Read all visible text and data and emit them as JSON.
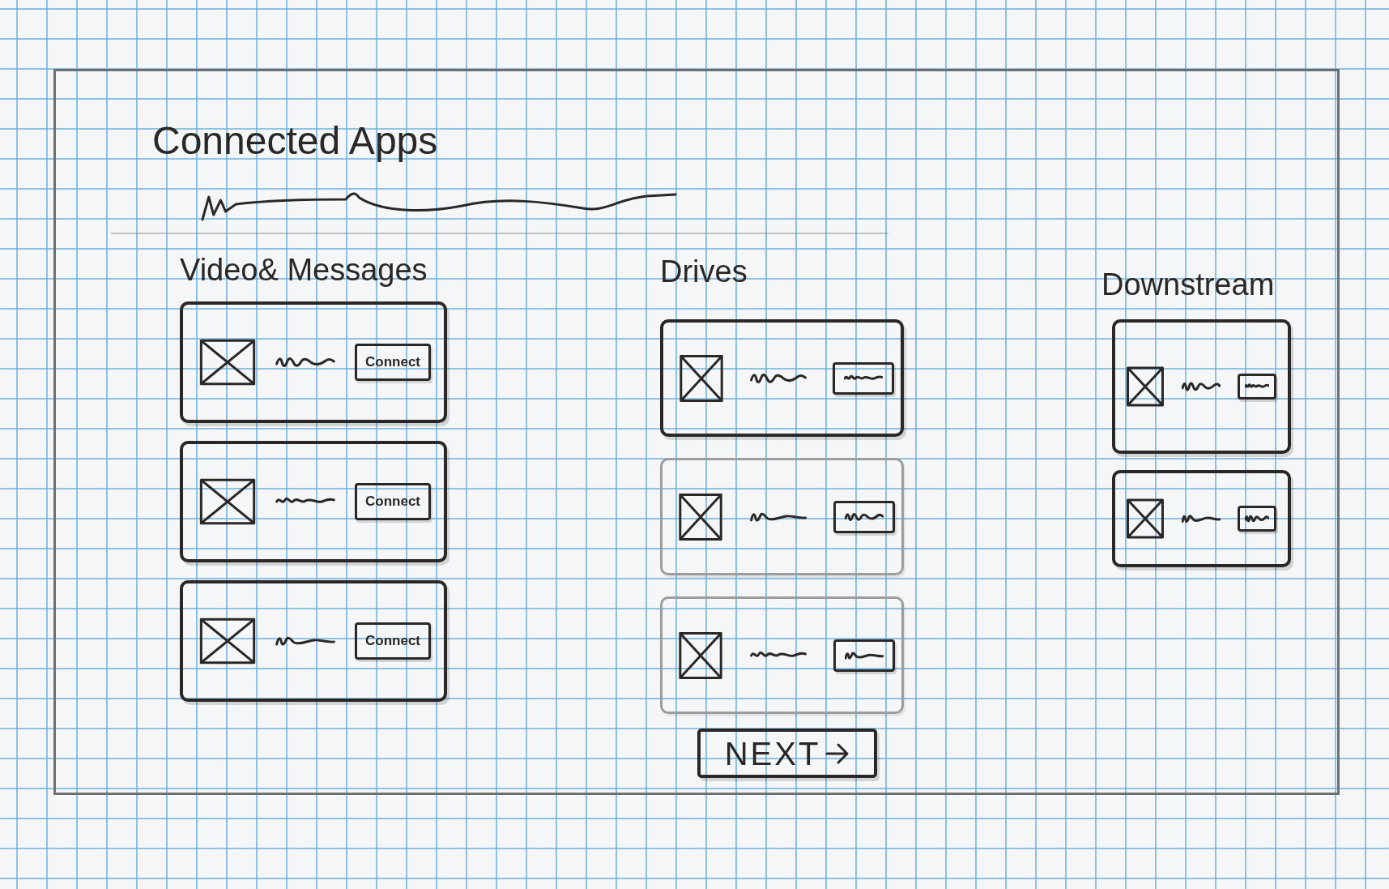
{
  "title": "Connected Apps",
  "columns": [
    {
      "heading": "Video& Messages",
      "cards": [
        {
          "dimmed": false,
          "button": {
            "kind": "text",
            "label": "Connect"
          }
        },
        {
          "dimmed": false,
          "button": {
            "kind": "text",
            "label": "Connect"
          }
        },
        {
          "dimmed": false,
          "button": {
            "kind": "text",
            "label": "Connect"
          }
        }
      ]
    },
    {
      "heading": "Drives",
      "cards": [
        {
          "dimmed": false,
          "button": {
            "kind": "scribble"
          }
        },
        {
          "dimmed": true,
          "button": {
            "kind": "scribble"
          }
        },
        {
          "dimmed": true,
          "button": {
            "kind": "scribble"
          }
        }
      ]
    },
    {
      "heading": "Downstream",
      "cards": [
        {
          "dimmed": false,
          "button": {
            "kind": "scribble"
          }
        },
        {
          "dimmed": false,
          "button": {
            "kind": "scribble"
          }
        }
      ]
    }
  ],
  "next_button": {
    "label": "NEXT"
  }
}
